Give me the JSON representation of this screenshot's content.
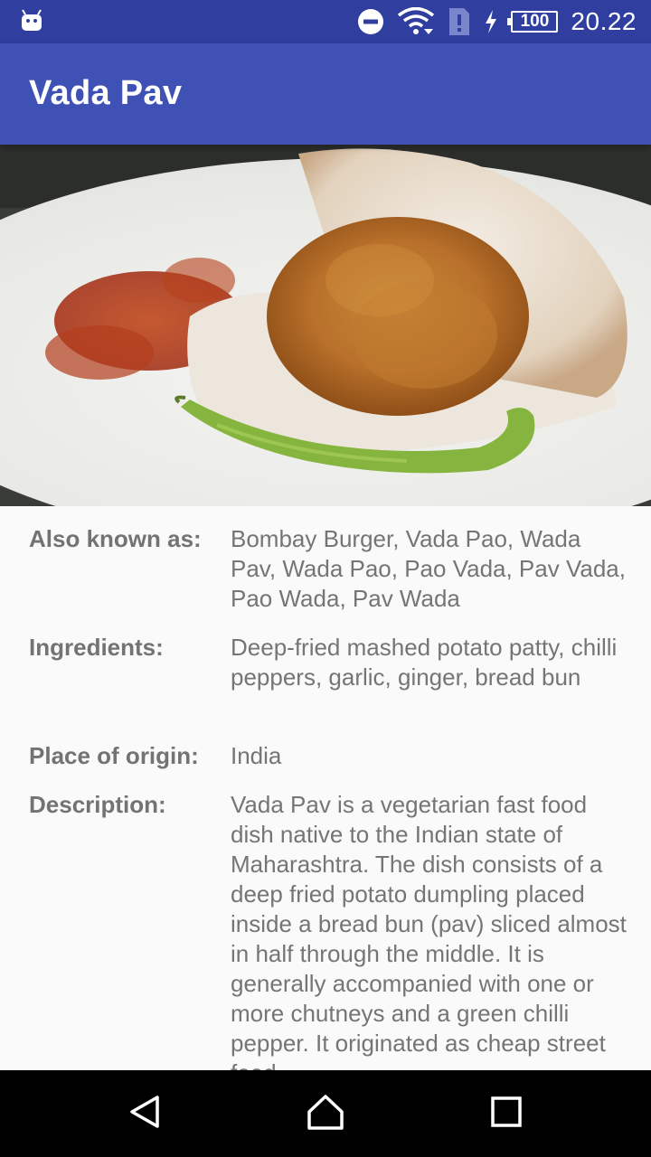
{
  "status_bar": {
    "battery_level": "100",
    "time": "20.22",
    "icons": [
      "android-icon",
      "dnd-icon",
      "wifi-icon",
      "sim-alert-icon",
      "charging-icon",
      "battery-icon"
    ]
  },
  "app_bar": {
    "title": "Vada Pav"
  },
  "hero_image": {
    "alt": "vada-pav-photo"
  },
  "details": {
    "also_known_as": {
      "label": "Also known as:",
      "value": "Bombay Burger, Vada Pao, Wada Pav, Wada Pao, Pao Vada, Pav Vada, Pao Wada, Pav Wada"
    },
    "ingredients": {
      "label": "Ingredients:",
      "value": "Deep-fried mashed potato patty, chilli peppers, garlic, ginger, bread bun"
    },
    "place_of_origin": {
      "label": "Place of origin:",
      "value": "India"
    },
    "description": {
      "label": "Description:",
      "value": "Vada Pav is a vegetarian fast food dish native to the Indian state of Maharashtra. The dish consists of a deep fried potato dumpling placed inside a bread bun (pav) sliced almost in half through the middle. It is generally accompanied with one or more chutneys and a green chilli pepper. It originated as cheap street food"
    }
  },
  "nav_bar": {
    "buttons": [
      "back-icon",
      "home-icon",
      "recents-icon"
    ]
  },
  "colors": {
    "status_bar": "#303f9f",
    "app_bar": "#3f51b5",
    "label_text": "#737373",
    "value_text": "#757575"
  }
}
